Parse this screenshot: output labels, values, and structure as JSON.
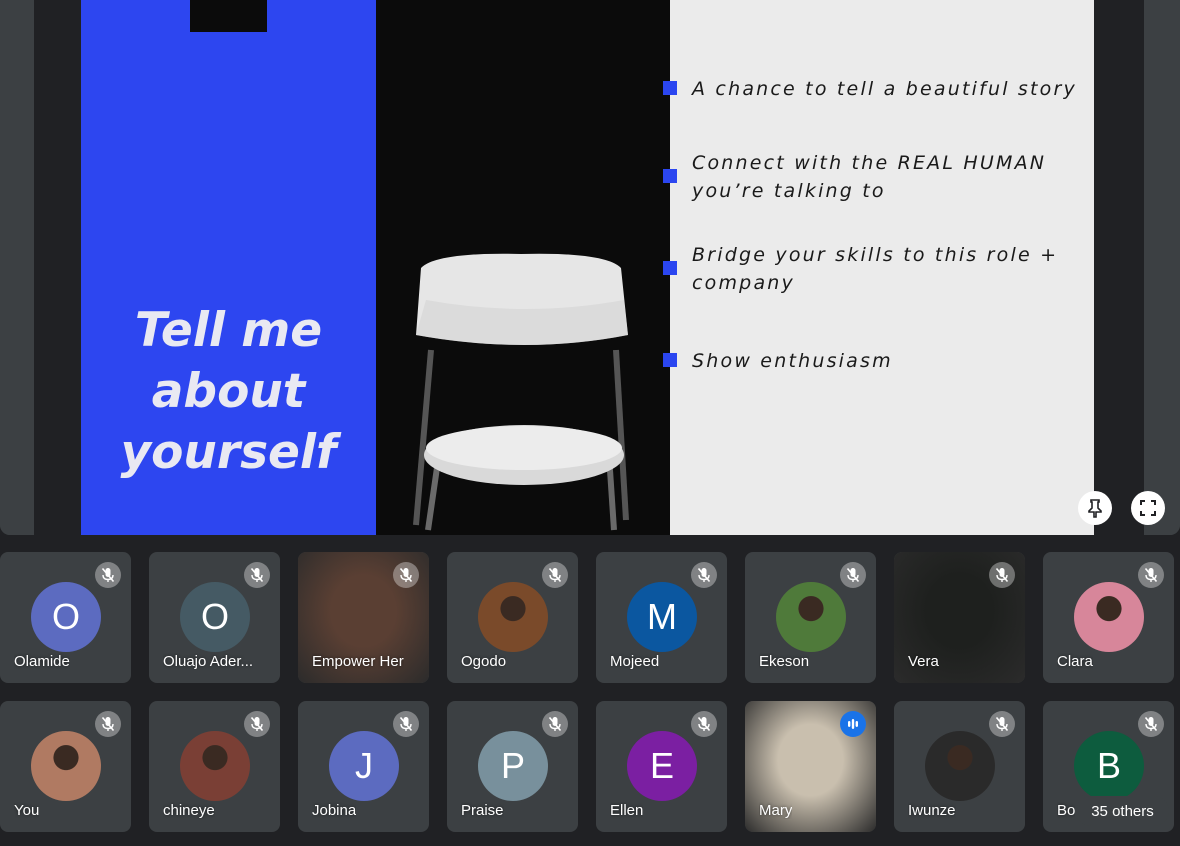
{
  "slide": {
    "title": "Tell me\nabout\nyourself",
    "bullets": [
      "A chance to tell a beautiful story",
      "Connect with the REAL HUMAN\nyou’re talking to",
      "Bridge your skills to this role +\ncompany",
      "Show enthusiasm"
    ],
    "colors": {
      "accent": "#2d46f0",
      "dark": "#0b0b0b",
      "light": "#ebebeb"
    }
  },
  "controls": {
    "pin_icon": "pin-icon",
    "fullscreen_icon": "fullscreen-icon"
  },
  "participants": [
    {
      "name": "Olamide",
      "initial": "O",
      "color": "#5c6bc0",
      "muted": true
    },
    {
      "name": "Oluajo Ader...",
      "initial": "O",
      "color": "#455a64",
      "muted": true
    },
    {
      "name": "Empower Her",
      "initial": "",
      "color": "#5a3f33",
      "muted": true,
      "video": true
    },
    {
      "name": "Ogodo",
      "initial": "",
      "color": "#7a4a2a",
      "muted": true,
      "photo": true
    },
    {
      "name": "Mojeed",
      "initial": "M",
      "color": "#0b57a0",
      "muted": true
    },
    {
      "name": "Ekeson",
      "initial": "",
      "color": "#4f7a3a",
      "muted": true,
      "photo": true
    },
    {
      "name": "Vera",
      "initial": "",
      "color": "#1e201e",
      "muted": true,
      "video": true
    },
    {
      "name": "Clara",
      "initial": "",
      "color": "#d7869a",
      "muted": true,
      "photo": true
    },
    {
      "name": "You",
      "initial": "",
      "color": "#b07a62",
      "muted": true,
      "photo": true
    },
    {
      "name": "chineye",
      "initial": "",
      "color": "#7a3f35",
      "muted": true,
      "photo": true
    },
    {
      "name": "Jobina",
      "initial": "J",
      "color": "#5c6bc0",
      "muted": true
    },
    {
      "name": "Praise",
      "initial": "P",
      "color": "#78909c",
      "muted": true
    },
    {
      "name": "Ellen",
      "initial": "E",
      "color": "#7b1fa2",
      "muted": true
    },
    {
      "name": "Mary",
      "initial": "",
      "color": "#c9bfae",
      "muted": false,
      "video": true
    },
    {
      "name": "Iwunze",
      "initial": "",
      "color": "#2a2a2a",
      "muted": true,
      "photo": true
    },
    {
      "name": "Bo",
      "initial": "B",
      "color": "#0d5c3e",
      "muted": true
    }
  ],
  "others_label": "35 others"
}
